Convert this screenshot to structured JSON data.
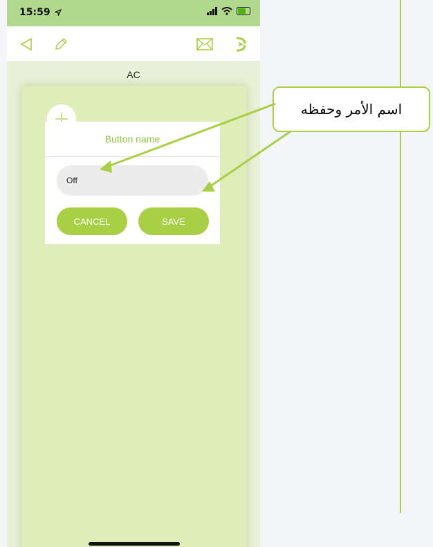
{
  "status_bar": {
    "time": "15:59"
  },
  "screen": {
    "title": "AC"
  },
  "dialog": {
    "title": "Button name",
    "input_value": "Off",
    "cancel_label": "CANCEL",
    "save_label": "SAVE"
  },
  "annotation": {
    "text": "اسم الأمر وحفظه"
  },
  "colors": {
    "accent": "#a9cf45",
    "status_bar": "#b1d98d",
    "card": "#dfedb9"
  },
  "icons": [
    "location-arrow-icon",
    "signal-icon",
    "wifi-icon",
    "battery-icon",
    "back-icon",
    "edit-icon",
    "mail-icon",
    "ir-icon",
    "plus-icon"
  ]
}
